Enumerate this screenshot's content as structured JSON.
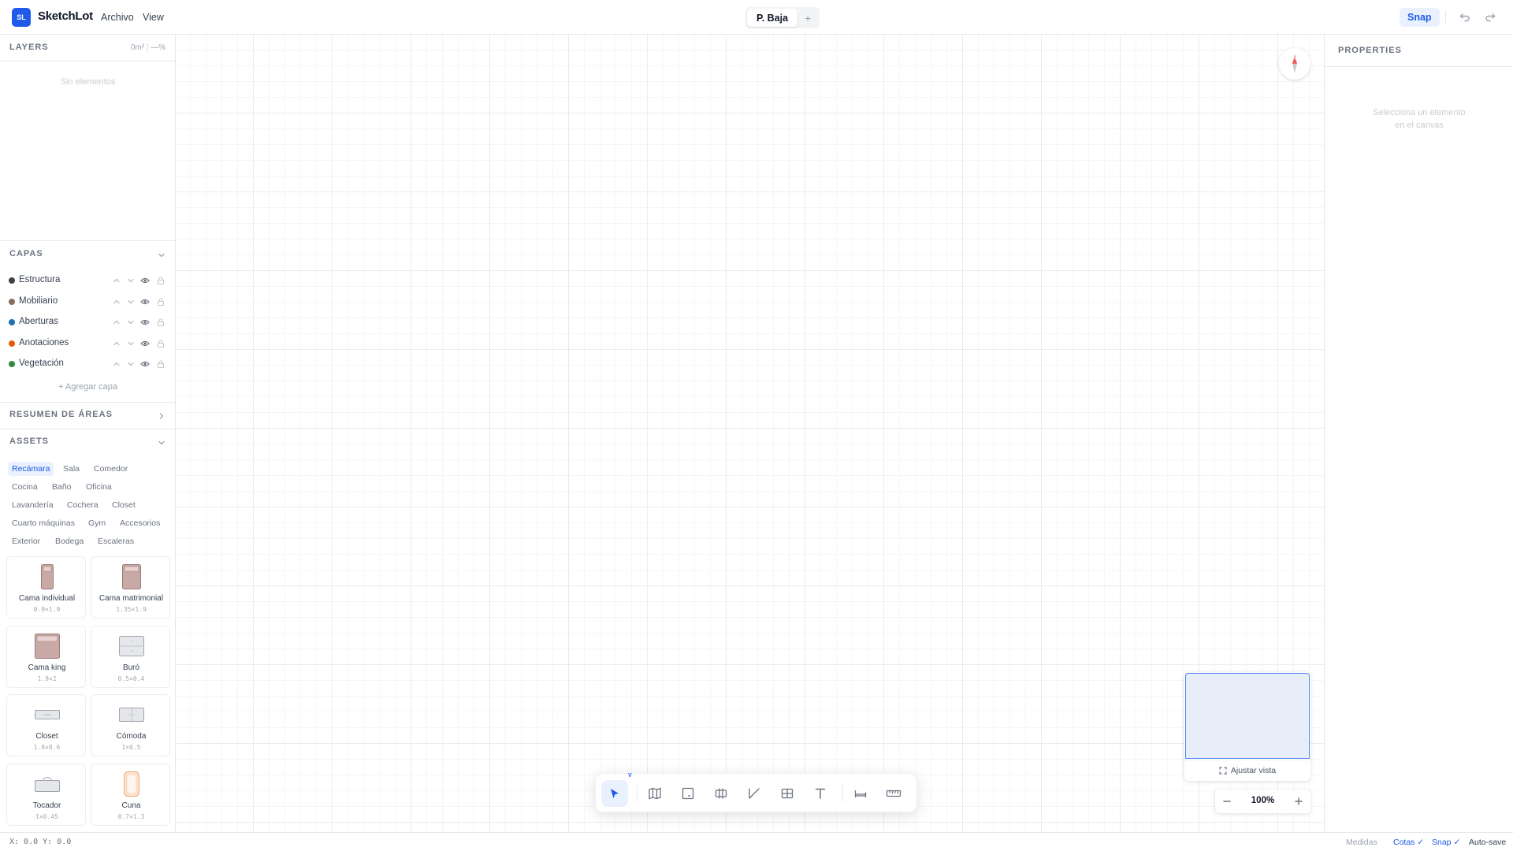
{
  "app": {
    "logo": "SL",
    "title": "SketchLot"
  },
  "menu": [
    "Archivo",
    "View"
  ],
  "floor_tabs": {
    "active": "P. Baja",
    "add": "+"
  },
  "toolbar_top": {
    "snap": "Snap"
  },
  "layers_panel": {
    "title": "LAYERS",
    "area": "0m²",
    "percent": "—%",
    "empty": "Sin elementos"
  },
  "capas": {
    "title": "CAPAS",
    "items": [
      {
        "name": "Estructura",
        "color": "#3f3f46"
      },
      {
        "name": "Mobiliario",
        "color": "#8b6b5b"
      },
      {
        "name": "Aberturas",
        "color": "#1f6fb5"
      },
      {
        "name": "Anotaciones",
        "color": "#e8590c"
      },
      {
        "name": "Vegetación",
        "color": "#2f8a3e"
      }
    ],
    "add_label": "Agregar capa"
  },
  "area_summary": {
    "title": "RESUMEN DE ÁREAS"
  },
  "assets": {
    "title": "ASSETS",
    "categories": [
      "Recámara",
      "Sala",
      "Comedor",
      "Cocina",
      "Baño",
      "Oficina",
      "Lavandería",
      "Cochera",
      "Closet",
      "Cuarto máquinas",
      "Gym",
      "Accesorios",
      "Exterior",
      "Bodega",
      "Escaleras"
    ],
    "active_category": "Recámara",
    "items": [
      {
        "name": "Cama individual",
        "dims": "0.9×1.9",
        "icon": "single-bed-icon"
      },
      {
        "name": "Cama matrimonial",
        "dims": "1.35×1.9",
        "icon": "double-bed-icon"
      },
      {
        "name": "Cama king",
        "dims": "1.9×2",
        "icon": "king-bed-icon"
      },
      {
        "name": "Buró",
        "dims": "0.5×0.4",
        "icon": "nightstand-icon"
      },
      {
        "name": "Closet",
        "dims": "1.8×0.6",
        "icon": "closet-icon"
      },
      {
        "name": "Cómoda",
        "dims": "1×0.5",
        "icon": "dresser-icon"
      },
      {
        "name": "Tocador",
        "dims": "1×0.45",
        "icon": "vanity-icon"
      },
      {
        "name": "Cuna",
        "dims": "0.7×1.3",
        "icon": "crib-icon"
      }
    ]
  },
  "canvas": {
    "compass": "N",
    "tools": [
      "select-tool",
      "plan-tool",
      "room-tool",
      "wall-tool",
      "line-tool",
      "window-tool",
      "text-tool",
      "furniture-tool",
      "measure-tool"
    ],
    "active_tool": "select-tool",
    "select_hotkey": "V",
    "fit_view": "Ajustar vista",
    "zoom": "100%"
  },
  "properties": {
    "title": "PROPERTIES",
    "empty_line1": "Selecciona un elemento",
    "empty_line2": "en el canvas"
  },
  "status": {
    "coords": "X: 0.0  Y: 0.0",
    "measures": "Medidas",
    "cotas": "Cotas ✓",
    "snap": "Snap ✓",
    "autosave": "Auto-save"
  },
  "colors": {
    "accent": "#1f5ae8",
    "accent_light": "#eaf1fe"
  }
}
